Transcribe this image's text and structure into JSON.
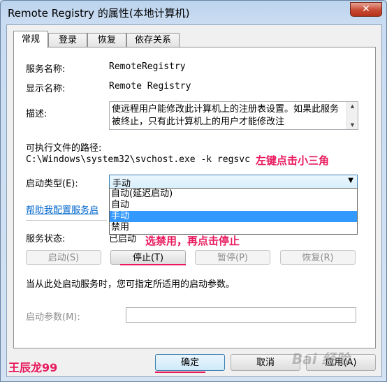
{
  "window": {
    "title": "Remote Registry 的属性(本地计算机)",
    "close_symbol": "✕"
  },
  "tabs": [
    {
      "label": "常规",
      "active": true
    },
    {
      "label": "登录",
      "active": false
    },
    {
      "label": "恢复",
      "active": false
    },
    {
      "label": "依存关系",
      "active": false
    }
  ],
  "general": {
    "service_name_label": "服务名称:",
    "service_name_value": "RemoteRegistry",
    "display_name_label": "显示名称:",
    "display_name_value": "Remote Registry",
    "description_label": "描述:",
    "description_value": "使远程用户能修改此计算机上的注册表设置。如果此服务被终止，只有此计算机上的用户才能修改注",
    "exe_path_label": "可执行文件的路径:",
    "exe_path_value": "C:\\Windows\\system32\\svchost.exe -k regsvc",
    "startup_type_label": "启动类型(E):",
    "startup_type_value": "手动",
    "startup_options": [
      "自动(延迟启动)",
      "自动",
      "手动",
      "禁用"
    ],
    "help_link": "帮助我配置服务启",
    "service_status_label": "服务状态:",
    "service_status_value": "已启动",
    "start_button": "启动(S)",
    "stop_button": "停止(T)",
    "pause_button": "暂停(P)",
    "resume_button": "恢复(R)",
    "start_hint": "当从此处启动服务时，您可指定所适用的启动参数。",
    "start_params_label": "启动参数(M):",
    "start_params_value": ""
  },
  "footer": {
    "ok_button": "确定",
    "cancel_button": "取消",
    "apply_button": "应用(A)"
  },
  "annotations": {
    "tip_triangle": "左键点击小三角",
    "tip_disable_stop": "选禁用，再点击停止",
    "signature": "王辰龙99",
    "watermark": "Bai 经验"
  },
  "colors": {
    "annotation": "#e8195c",
    "selection": "#3399ff",
    "link": "#0066cc"
  }
}
